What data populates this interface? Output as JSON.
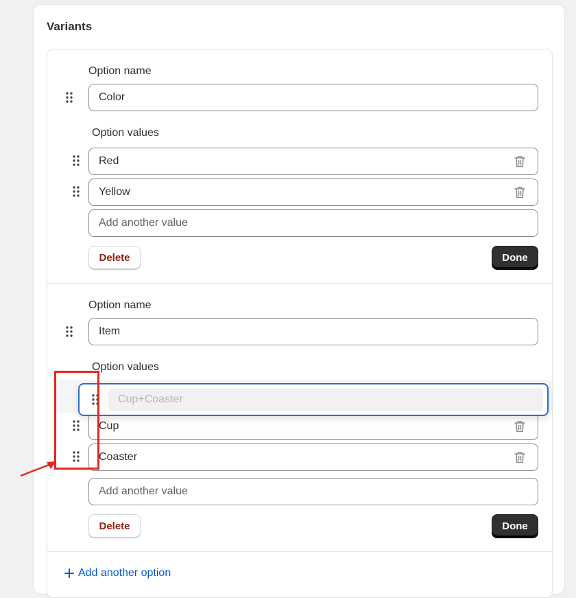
{
  "card": {
    "title": "Variants"
  },
  "options": [
    {
      "name_label": "Option name",
      "name_value": "Color",
      "values_label": "Option values",
      "values": [
        "Red",
        "Yellow"
      ],
      "add_value_placeholder": "Add another value",
      "delete_label": "Delete",
      "done_label": "Done"
    },
    {
      "name_label": "Option name",
      "name_value": "Item",
      "values_label": "Option values",
      "dragging_value": "Cup+Coaster",
      "values": [
        "Cup",
        "Coaster"
      ],
      "add_value_placeholder": "Add another value",
      "delete_label": "Delete",
      "done_label": "Done"
    }
  ],
  "add_option_label": "Add another option",
  "colors": {
    "accent": "#005bd3",
    "drag_border": "#2c6ecb",
    "delete_text": "#8e1f0b",
    "done_bg": "#303030",
    "annotation_red": "#e5261f"
  },
  "icons": [
    "drag-handle-icon",
    "trash-icon",
    "plus-icon",
    "annotation-arrow"
  ]
}
